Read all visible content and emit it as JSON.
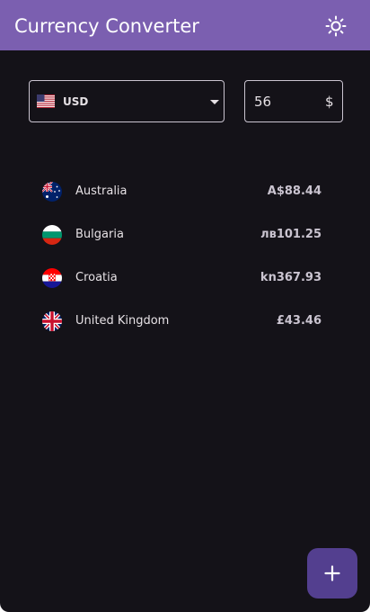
{
  "app": {
    "title": "Currency Converter"
  },
  "colors": {
    "appbar": "#7b5fb0",
    "background": "#141218",
    "fab": "#533f8f",
    "text": "#e6e1e5"
  },
  "header": {
    "theme_toggle_icon": "sun-icon"
  },
  "converter": {
    "base_currency": {
      "code": "USD",
      "flag": "us-flag-icon"
    },
    "amount": {
      "value": "56",
      "suffix": "$"
    }
  },
  "results": [
    {
      "country": "Australia",
      "value": "A$88.44",
      "flag": "australia-flag-icon"
    },
    {
      "country": "Bulgaria",
      "value": "лв101.25",
      "flag": "bulgaria-flag-icon"
    },
    {
      "country": "Croatia",
      "value": "kn367.93",
      "flag": "croatia-flag-icon"
    },
    {
      "country": "United Kingdom",
      "value": "£43.46",
      "flag": "uk-flag-icon"
    }
  ],
  "fab": {
    "label": "+",
    "icon": "plus-icon"
  }
}
